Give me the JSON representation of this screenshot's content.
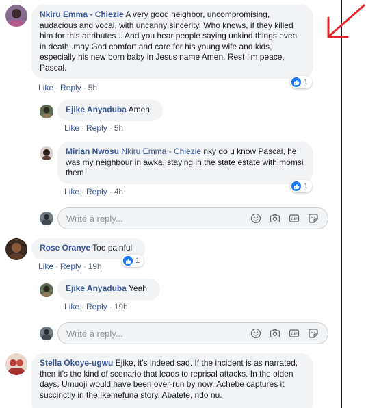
{
  "comments": [
    {
      "author": "Nkiru Emma - Chiezie",
      "text": " A very good neighbor, uncompromising, audacious and vocal, with uncanny sincerity. Who knows, if they killed him for this attributes... And you hear people saying unkind things even in death..may God comfort and care for his young wife and kids, especially his new born baby in Jesus name Amen. Rest I'm peace, Pascal.",
      "like": "Like",
      "reply": "Reply",
      "time": "5h",
      "reactions": "1"
    },
    {
      "author": "Ejike Anyaduba",
      "text": " Amen",
      "like": "Like",
      "reply": "Reply",
      "time": "5h"
    },
    {
      "author": "Mirian Nwosu",
      "tag": " Nkiru Emma - Chiezie",
      "text": " nky do u know Pascal, he was my neighbour in awka, staying in the state estate with momsi them",
      "like": "Like",
      "reply": "Reply",
      "time": "4h",
      "reactions": "1"
    },
    {
      "author": "Rose Oranye",
      "text": " Too painful",
      "like": "Like",
      "reply": "Reply",
      "time": "19h",
      "reactions": "1"
    },
    {
      "author": "Ejike Anyaduba",
      "text": " Yeah",
      "like": "Like",
      "reply": "Reply",
      "time": "19h"
    },
    {
      "author": "Stella Okoye-ugwu",
      "text": " Ejike, it's indeed sad. If the incident is as narrated, then it's the kind of scenario that leads to reprisal attacks. In the olden days, Umuoji would have been over-run by now. Achebe captures it succinctly in the Ikemefuna story. Abatete, ndo nu."
    }
  ],
  "reply_box": {
    "placeholder": "Write a reply..."
  },
  "icons": [
    "emoji-icon",
    "camera-icon",
    "gif-icon",
    "sticker-icon",
    "like-reaction-icon",
    "red-arrow-annotation"
  ],
  "colors": {
    "name": "#385898",
    "bubble": "#f2f3f5",
    "like_blue": "#1877f2",
    "annotation": "#e3262b"
  }
}
